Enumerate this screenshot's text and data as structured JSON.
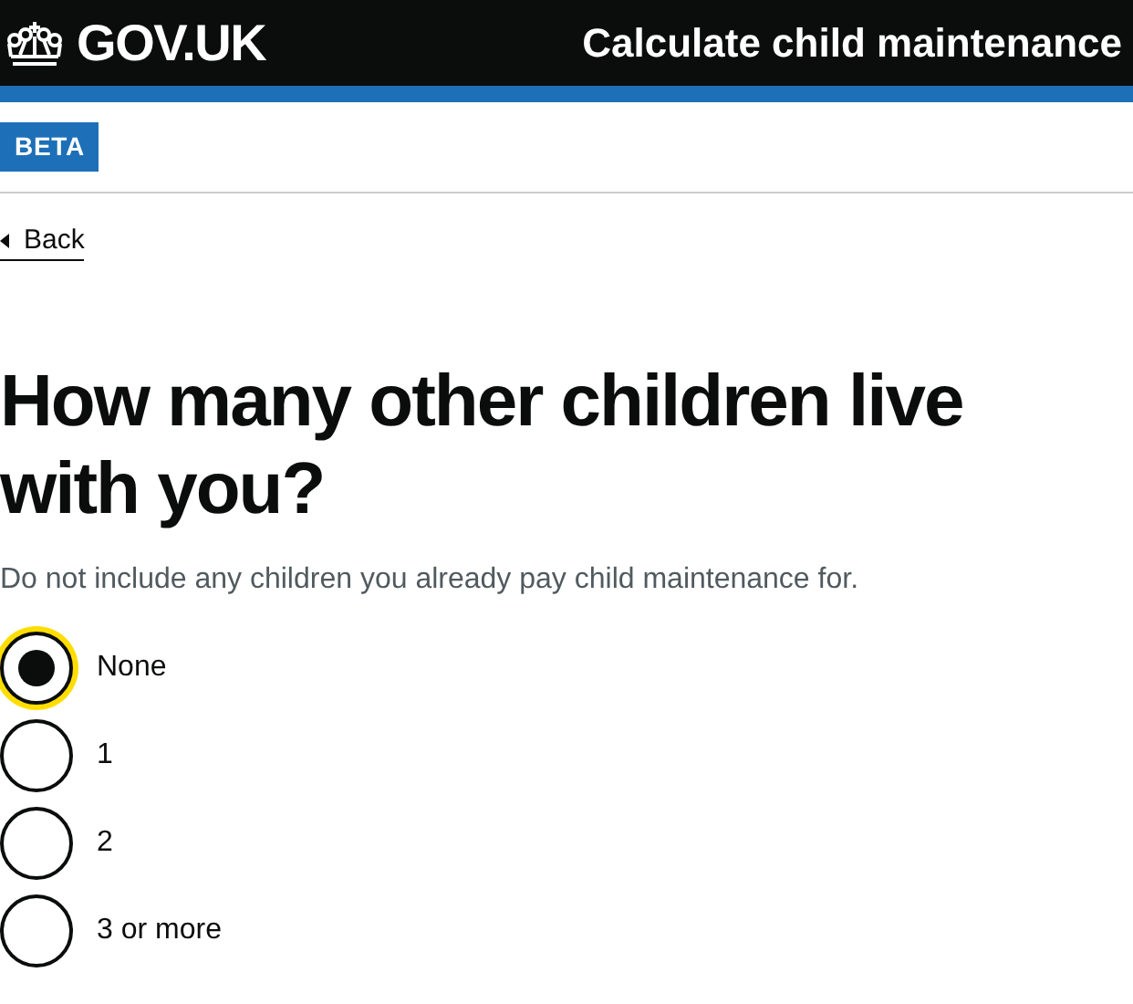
{
  "header": {
    "logo": "GOV.UK",
    "service": "Calculate child maintenance"
  },
  "phase_tag": "BETA",
  "back_link": "Back",
  "question": "How many other children live with you?",
  "hint": "Do not include any children you already pay child maintenance for.",
  "options": [
    {
      "label": "None",
      "selected": true,
      "focused": true
    },
    {
      "label": "1",
      "selected": false,
      "focused": false
    },
    {
      "label": "2",
      "selected": false,
      "focused": false
    },
    {
      "label": "3 or more",
      "selected": false,
      "focused": false
    }
  ]
}
